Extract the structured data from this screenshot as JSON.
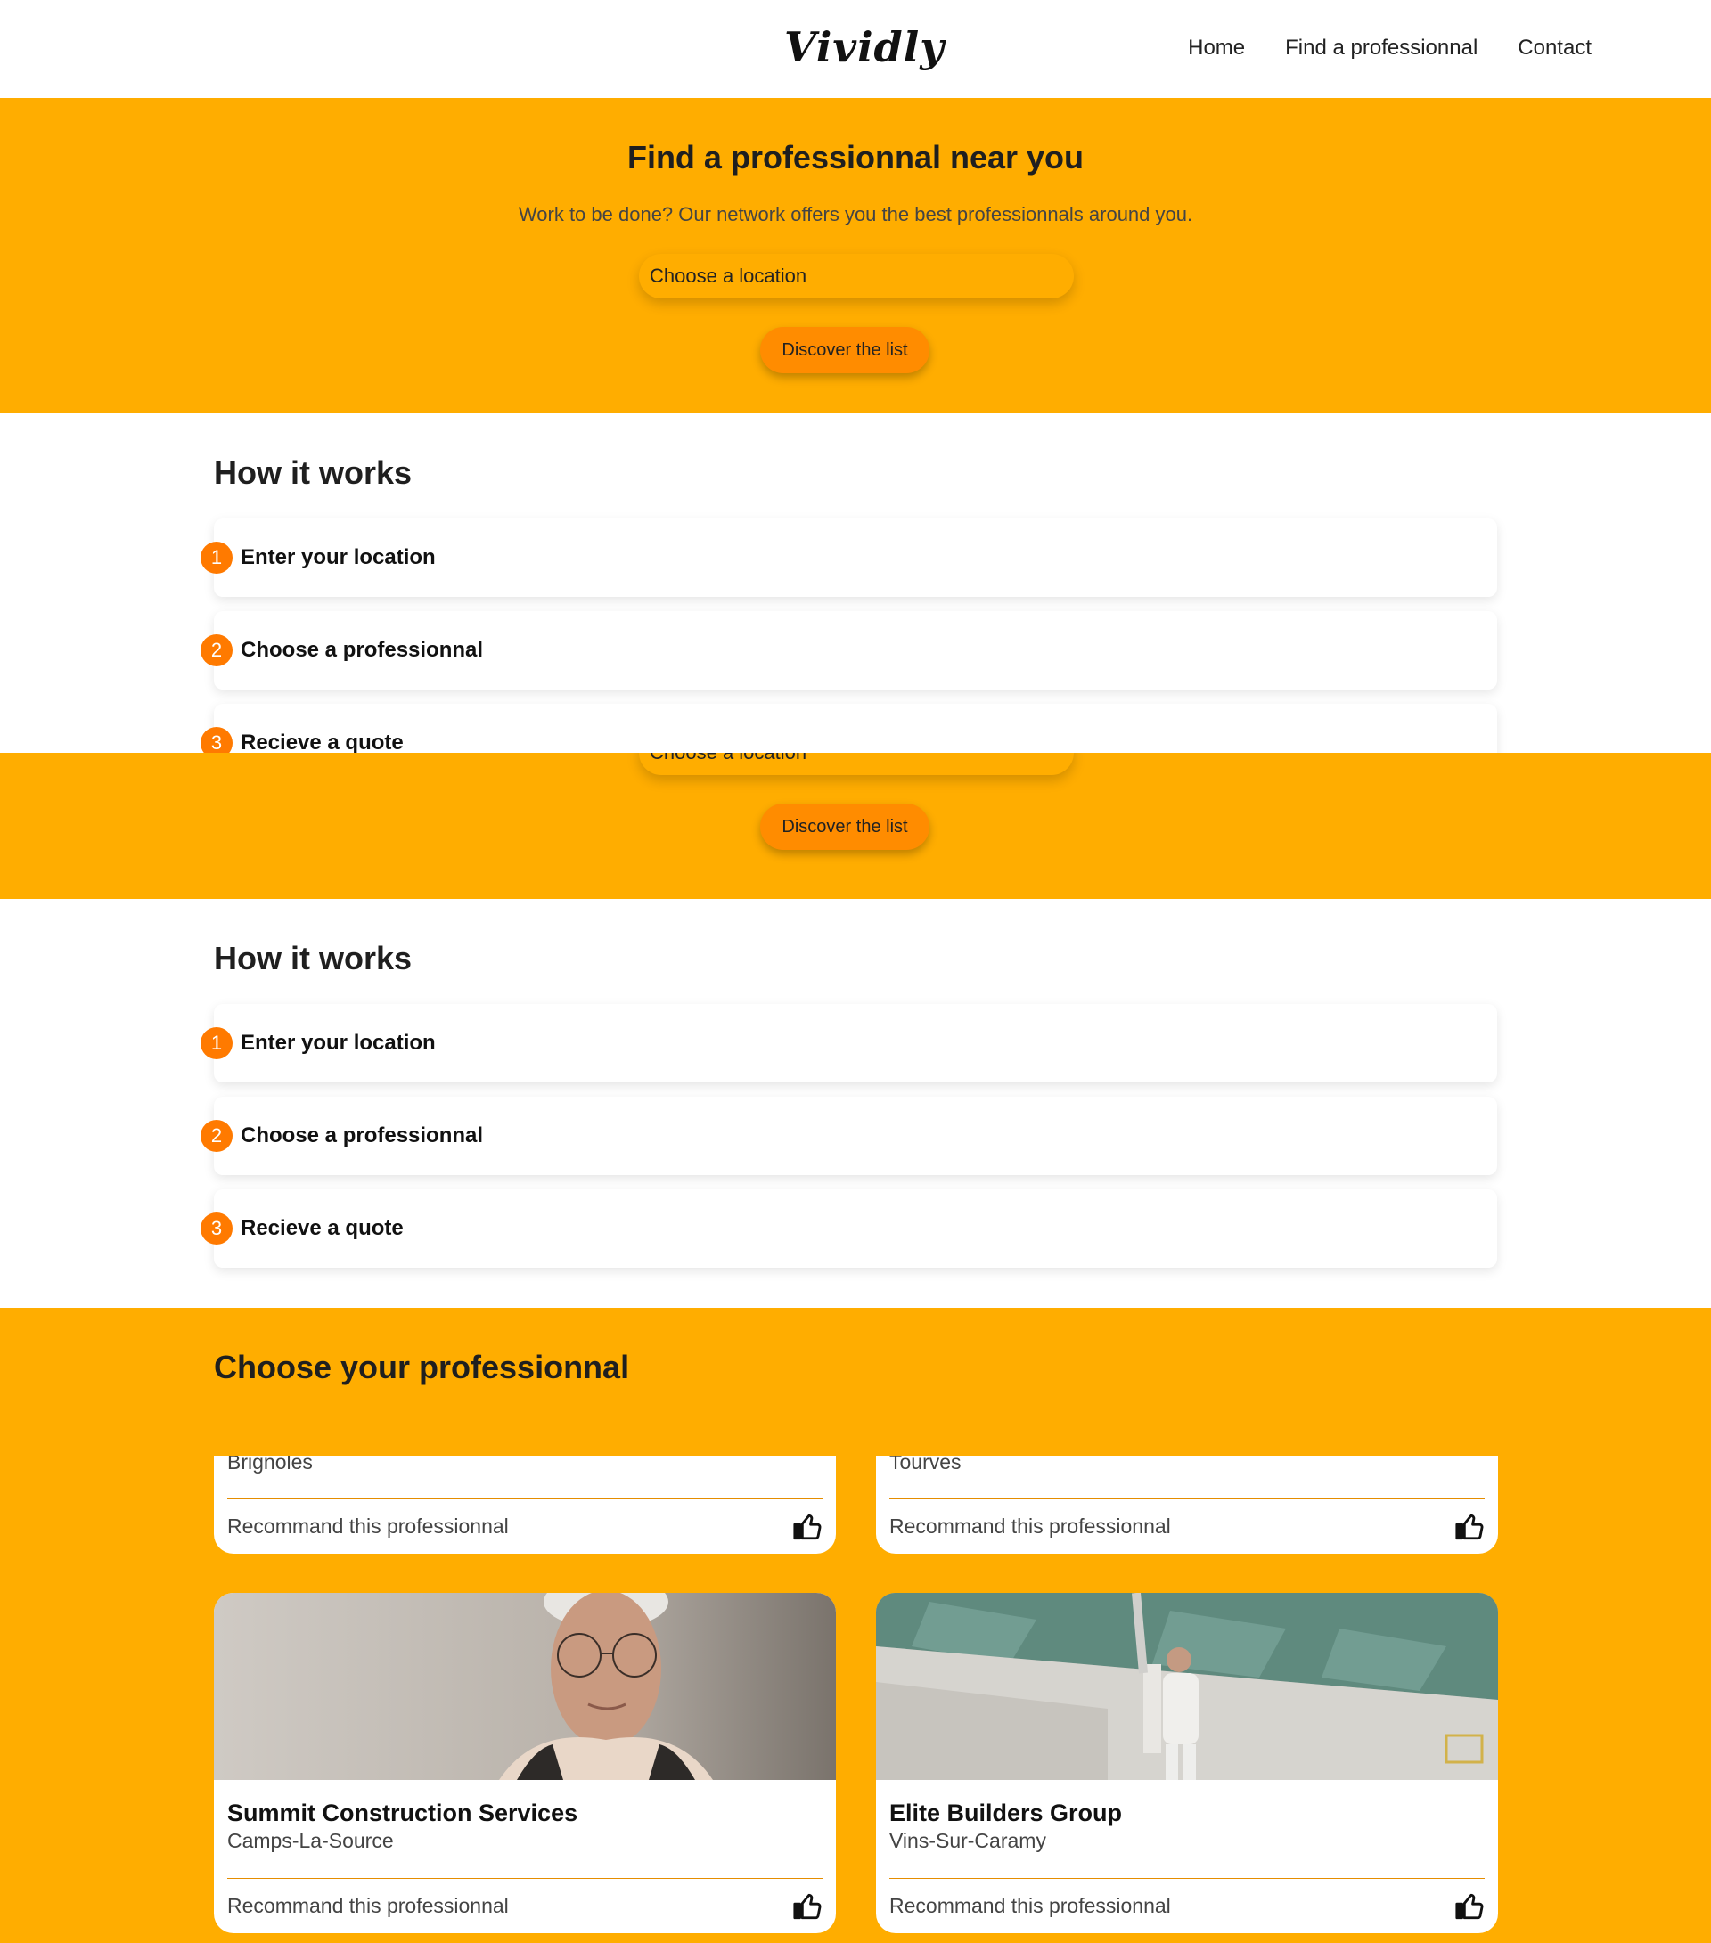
{
  "header": {
    "logo": "Vividly",
    "nav": [
      "Home",
      "Find a professionnal",
      "Contact"
    ]
  },
  "hero": {
    "title": "Find a professionnal near you",
    "subtitle": "Work to be done? Our network offers you the best professionnals around you.",
    "location_placeholder": "Choose a location",
    "cta_label": "Discover the list"
  },
  "how": {
    "title": "How it works",
    "steps": [
      {
        "num": "1",
        "label": "Enter your location"
      },
      {
        "num": "2",
        "label": "Choose a professionnal"
      },
      {
        "num": "3",
        "label": "Recieve a quote"
      }
    ]
  },
  "pros": {
    "title": "Choose your professionnal",
    "recommend_label": "Recommand this professionnal",
    "cards": [
      {
        "name": "",
        "city": "Brignoles"
      },
      {
        "name": "",
        "city": "Tourves"
      },
      {
        "name": "Summit Construction Services",
        "city": "Camps-La-Source"
      },
      {
        "name": "Elite Builders Group",
        "city": "Vins-Sur-Caramy"
      }
    ]
  },
  "colors": {
    "accent": "#ffad00",
    "button": "#ff8c00",
    "step_badge": "#ff7a00"
  },
  "icons": {
    "recommend": "thumbs-up-icon"
  }
}
